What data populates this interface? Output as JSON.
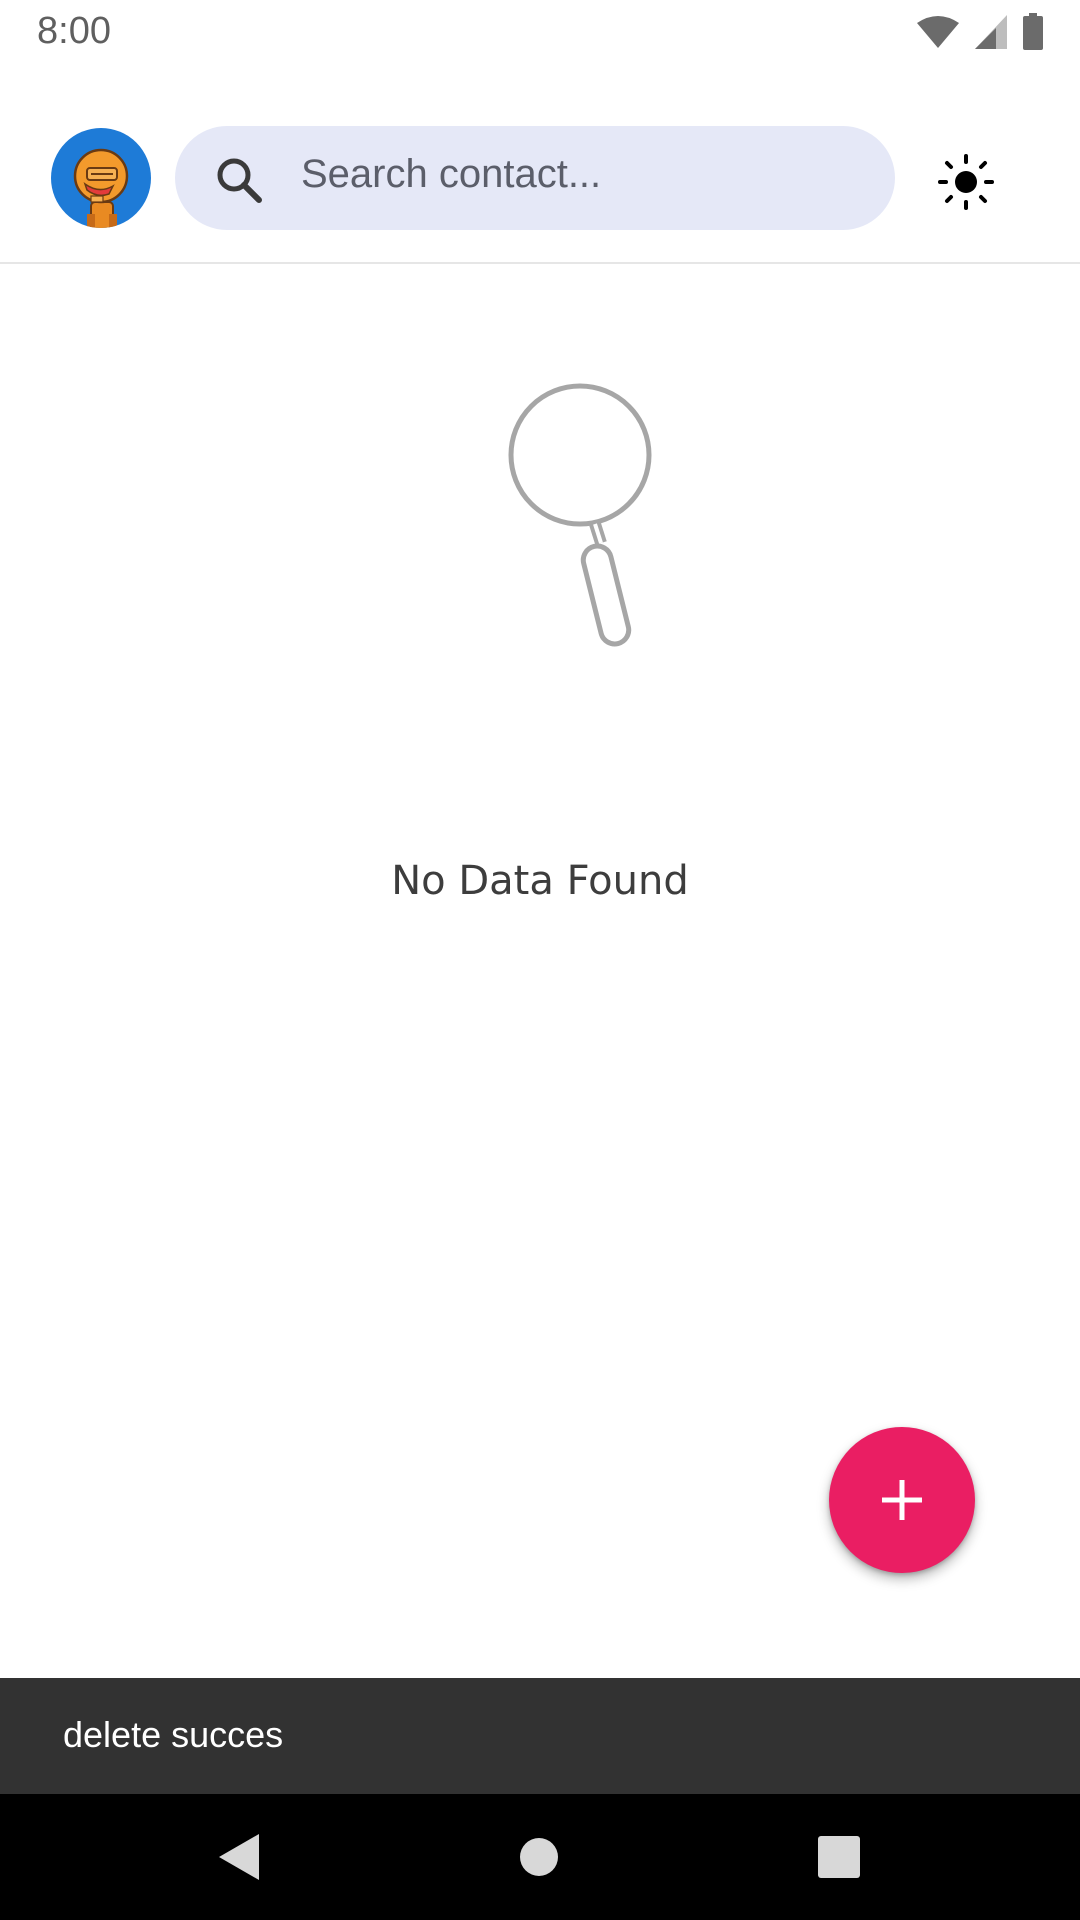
{
  "status_bar": {
    "time": "8:00",
    "icons": [
      "wifi-icon",
      "cellular-signal-icon",
      "battery-icon"
    ]
  },
  "header": {
    "avatar": "avatar-robot",
    "search": {
      "placeholder": "Search contact...",
      "value": "",
      "icon": "search-icon"
    },
    "theme_toggle_icon": "sun-icon"
  },
  "empty_state": {
    "icon": "magnifier-icon",
    "message": "No Data Found"
  },
  "fab": {
    "icon": "plus-icon"
  },
  "snackbar": {
    "message": "delete succes"
  },
  "nav_bar": {
    "buttons": [
      "back-icon",
      "home-icon",
      "recents-icon"
    ]
  },
  "colors": {
    "accent": "#ea1e63",
    "search_background": "#e5e8f7",
    "avatar_background": "#1e7bd7",
    "snackbar_background": "#323232"
  }
}
